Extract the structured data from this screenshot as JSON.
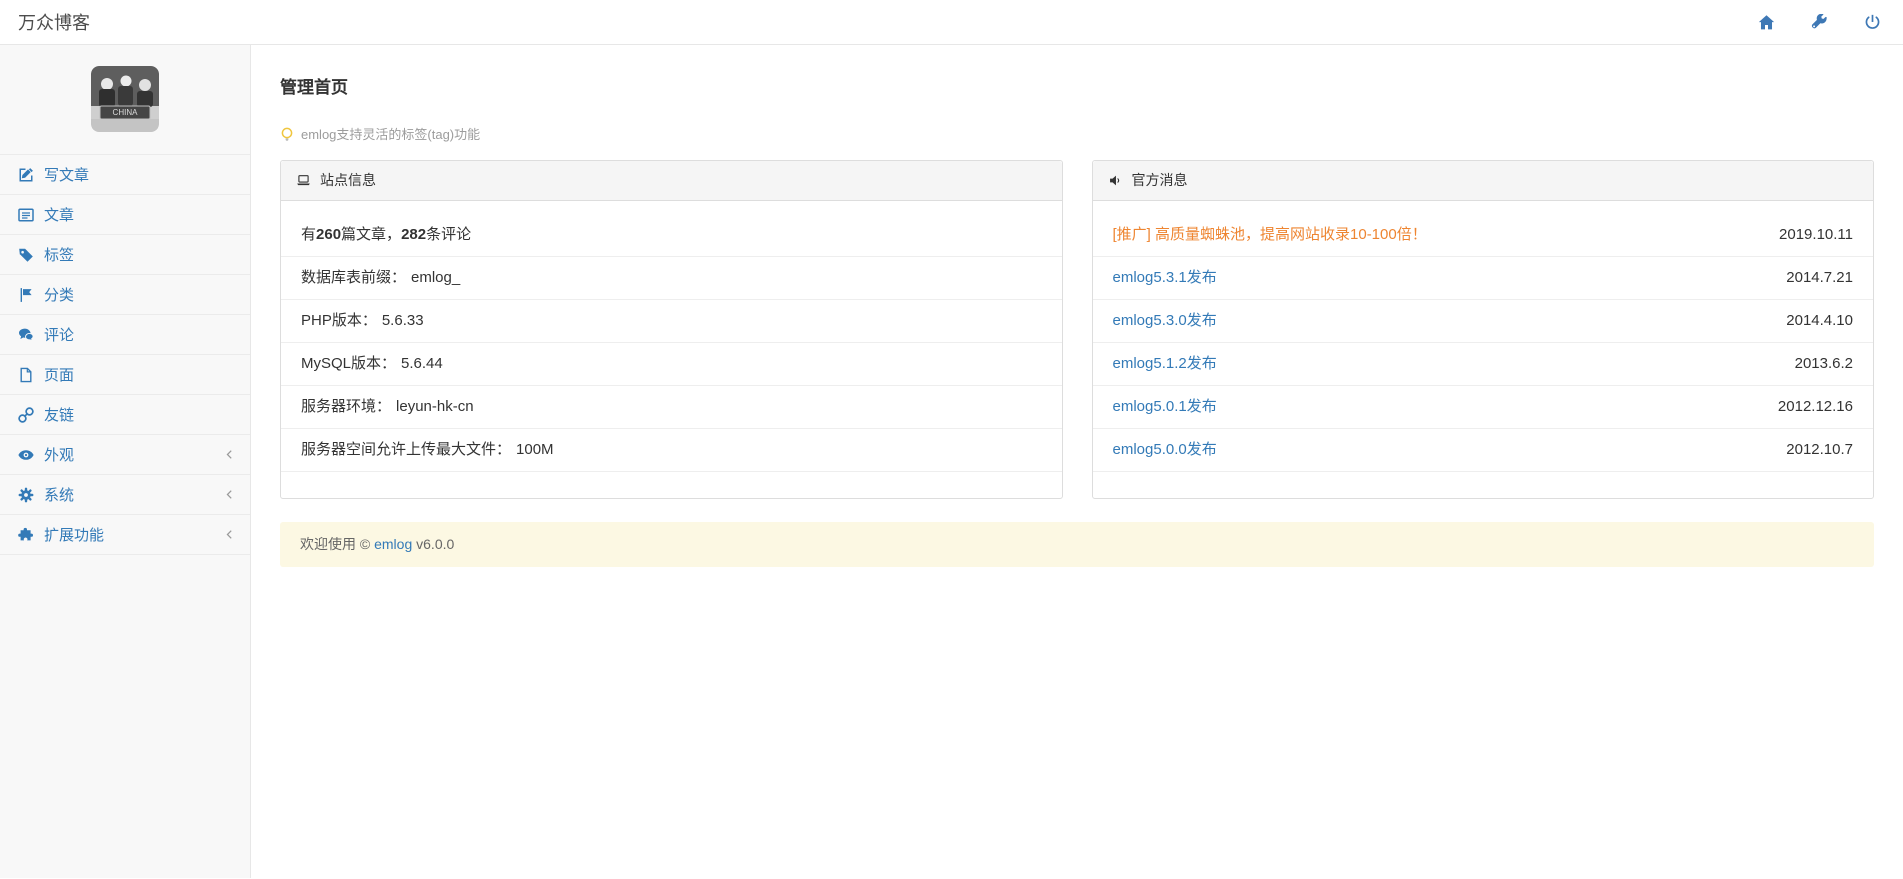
{
  "topbar": {
    "title": "万众博客",
    "icons": [
      {
        "name": "home-icon"
      },
      {
        "name": "wrench-icon"
      },
      {
        "name": "power-icon"
      }
    ]
  },
  "sidebar": {
    "avatar_text": "CHINA",
    "items": [
      {
        "label": "写文章",
        "icon": "pencil-square-icon",
        "has_submenu": false
      },
      {
        "label": "文章",
        "icon": "list-icon",
        "has_submenu": false
      },
      {
        "label": "标签",
        "icon": "tag-icon",
        "has_submenu": false
      },
      {
        "label": "分类",
        "icon": "flag-icon",
        "has_submenu": false
      },
      {
        "label": "评论",
        "icon": "comments-icon",
        "has_submenu": false
      },
      {
        "label": "页面",
        "icon": "page-icon",
        "has_submenu": false
      },
      {
        "label": "友链",
        "icon": "link-icon",
        "has_submenu": false
      },
      {
        "label": "外观",
        "icon": "eye-icon",
        "has_submenu": true
      },
      {
        "label": "系统",
        "icon": "gear-icon",
        "has_submenu": true
      },
      {
        "label": "扩展功能",
        "icon": "puzzle-icon",
        "has_submenu": true
      }
    ]
  },
  "main": {
    "page_title": "管理首页",
    "tip": "emlog支持灵活的标签(tag)功能",
    "site_info": {
      "title": "站点信息",
      "stats": {
        "prefix": "有",
        "articles": "260",
        "middle": "篇文章，",
        "comments": "282",
        "suffix": "条评论"
      },
      "rows": [
        {
          "label": "数据库表前缀：",
          "value": "emlog_"
        },
        {
          "label": "PHP版本：",
          "value": "5.6.33"
        },
        {
          "label": "MySQL版本：",
          "value": "5.6.44"
        },
        {
          "label": "服务器环境：",
          "value": "leyun-hk-cn"
        },
        {
          "label": "服务器空间允许上传最大文件：",
          "value": "100M"
        }
      ]
    },
    "news": {
      "title": "官方消息",
      "items": [
        {
          "text": "[推广] 高质量蜘蛛池，提高网站收录10-100倍！",
          "date": "2019.10.11",
          "promo": true
        },
        {
          "text": "emlog5.3.1发布",
          "date": "2014.7.21",
          "promo": false
        },
        {
          "text": "emlog5.3.0发布",
          "date": "2014.4.10",
          "promo": false
        },
        {
          "text": "emlog5.1.2发布",
          "date": "2013.6.2",
          "promo": false
        },
        {
          "text": "emlog5.0.1发布",
          "date": "2012.12.16",
          "promo": false
        },
        {
          "text": "emlog5.0.0发布",
          "date": "2012.10.7",
          "promo": false
        }
      ]
    },
    "footer": {
      "prefix": "欢迎使用 © ",
      "link_text": "emlog",
      "suffix": " v6.0.0"
    }
  },
  "colors": {
    "link_blue": "#337ab7",
    "promo_orange": "#ee8531",
    "footer_bg": "#fcf8e3",
    "sidebar_bg": "#f8f8f8",
    "panel_border": "#dddddd",
    "panel_header_bg": "#f5f5f5",
    "tip_gray": "#9c9c9c"
  }
}
